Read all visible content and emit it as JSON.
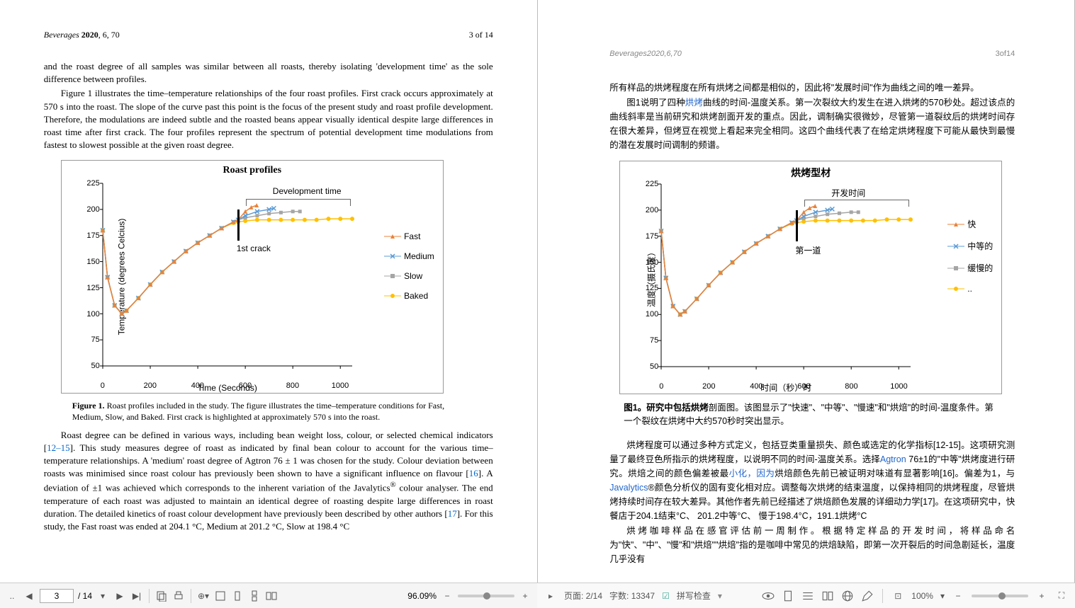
{
  "left": {
    "header": {
      "journal": "Beverages",
      "year": "2020",
      "vol": ", 6, 70",
      "pagenum": "3 of 14"
    },
    "para1_lead": "and the roast degree of all samples was similar between all roasts, thereby isolating 'development time' as the sole difference between profiles.",
    "para2": "Figure 1 illustrates the time–temperature relationships of the four roast profiles. First crack occurs approximately at 570 s into the roast. The slope of the curve past this point is the focus of the present study and roast profile development. Therefore, the modulations are indeed subtle and the roasted beans appear visually identical despite large differences in roast time after first crack. The four profiles represent the spectrum of potential development time modulations from fastest to slowest possible at the given roast degree.",
    "caption_b": "Figure 1.",
    "caption": " Roast profiles included in the study. The figure illustrates the time–temperature conditions for Fast, Medium, Slow, and Baked. First crack is highlighted at approximately 570 s into the roast.",
    "para3a": "Roast degree can be defined in various ways, including bean weight loss, colour, or selected chemical indicators [",
    "ref1": "12–15",
    "para3b": "]. This study measures degree of roast as indicated by final bean colour to account for the various time–temperature relationships. A 'medium' roast degree of Agtron 76 ± 1 was chosen for the study. Colour deviation between roasts was minimised since roast colour has previously been shown to have a significant influence on flavour [",
    "ref2": "16",
    "para3c": "]. A deviation of ±1 was achieved which corresponds to the inherent variation of the Javalytics",
    "reg": "®",
    "para3d": " colour analyser. The end temperature of each roast was adjusted to maintain an identical degree of roasting despite large differences in roast duration. The detailed kinetics of roast colour development have previously been described by other authors [",
    "ref3": "17",
    "para3e": "]. For this study, the Fast roast was ended at 204.1 °C, Medium at 201.2 °C, Slow at 198.4 °C"
  },
  "right": {
    "header": {
      "journal_full": "Beverages2020,6,70",
      "pagenum": "3of14"
    },
    "para1": "所有样品的烘烤程度在所有烘烤之间都是相似的，因此将\"发展时间\"作为曲线之间的唯一差异。",
    "para2a": "图1说明了四种",
    "link1": "烘烤",
    "para2b": "曲线的时间-温度关系。第一次裂纹大约发生在进入烘烤的570秒处。超过该点的曲线斜率是当前研究和烘烤剖面开发的重点。因此，调制确实很微妙，尽管第一道裂纹后的烘烤时间存在很大差异，但烤豆在视觉上看起来完全相同。这四个曲线代表了在给定烘烤程度下可能从最快到最慢的潜在发展时间调制的频谱。",
    "caption_b": "图1。研究中包括烘烤",
    "caption": "剖面图。该图显示了\"快速\"、\"中等\"、\"慢速\"和\"烘焙\"的时间-温度条件。第一个裂纹在烘烤中大约570秒时突出显示。",
    "para3a": "烘烤程度可以通过多种方式定义，包括豆类重量损失、颜色或选定的化学指标[12-15]。这项研究测量了最终豆色所指示的烘烤程度，以说明不同的时间-温度关系。选择",
    "link2": "Agtron",
    "para3b": " 76±1的\"中等\"烘烤度进行研究。烘焙之间的颜色偏差被最",
    "link3": "小化，因为",
    "para3c": "烘焙颜色先前已被证明对味道有显著影响[16]。偏差为1，与",
    "link4": "Javalytics",
    "para3d": "®颜色分析仪的固有变化相对应。调整每次烘烤的结束温度，以保持相同的烘烤程度，尽管烘烤持续时间存在较大差异。其他作者先前已经描述了烘焙颜色发展的详细动力学[17]。在这项研究中，快餐店于204.1结束°C、 201.2中等°C、 慢于198.4°C，191.1烘烤°C",
    "para4": "烘烤咖啡样品在感官评估前一周制作。根据特定样品的开发时间，将样品命名为\"快\"、\"中\"、\"慢\"和\"烘焙\"\"烘焙\"指的是咖啡中常见的烘焙缺陷，即第一次开裂后的时间急剧延长，温度几乎没有"
  },
  "chart_data": {
    "type": "line",
    "title_en": "Roast profiles",
    "title_cn": "烘烤型材",
    "xlabel_en": "Time (Seconds)",
    "xlabel_cn": "时间（秒）时",
    "ylabel_en": "Temperature (degrees Celcius)",
    "ylabel_cn": "温度（摄氏度）",
    "x_ticks": [
      0,
      200,
      400,
      600,
      800,
      1000
    ],
    "y_ticks": [
      50,
      75,
      100,
      125,
      150,
      175,
      200,
      225
    ],
    "x_range": [
      0,
      1050
    ],
    "y_range": [
      50,
      225
    ],
    "annotations": {
      "dev_en": "Development time",
      "dev_cn": "开发时间",
      "crack_en": "1st crack",
      "crack_cn": "第一道",
      "crack_x": 570
    },
    "series": [
      {
        "name_en": "Fast",
        "name_cn": "快",
        "color": "#E8833A",
        "marker": "triangle",
        "x": [
          0,
          20,
          50,
          80,
          100,
          150,
          200,
          250,
          300,
          350,
          400,
          450,
          500,
          550,
          570,
          600,
          625,
          648
        ],
        "y": [
          180,
          135,
          108,
          100,
          103,
          115,
          128,
          140,
          150,
          160,
          168,
          175,
          182,
          188,
          190,
          198,
          202,
          204
        ]
      },
      {
        "name_en": "Medium",
        "name_cn": "中等的",
        "color": "#5B9BD5",
        "marker": "x",
        "x": [
          0,
          20,
          50,
          80,
          100,
          150,
          200,
          250,
          300,
          350,
          400,
          450,
          500,
          550,
          570,
          600,
          650,
          700,
          720
        ],
        "y": [
          180,
          135,
          108,
          100,
          103,
          115,
          128,
          140,
          150,
          160,
          168,
          175,
          182,
          188,
          190,
          194,
          198,
          200,
          201
        ]
      },
      {
        "name_en": "Slow",
        "name_cn": "缓慢的",
        "color": "#A5A5A5",
        "marker": "square",
        "x": [
          0,
          20,
          50,
          80,
          100,
          150,
          200,
          250,
          300,
          350,
          400,
          450,
          500,
          550,
          570,
          600,
          650,
          700,
          750,
          800,
          830
        ],
        "y": [
          180,
          135,
          108,
          100,
          103,
          115,
          128,
          140,
          150,
          160,
          168,
          175,
          182,
          188,
          190,
          192,
          194,
          196,
          197,
          198,
          198
        ]
      },
      {
        "name_en": "Baked",
        "name_cn": "..",
        "color": "#FFC000",
        "marker": "circle",
        "x": [
          0,
          20,
          50,
          80,
          100,
          150,
          200,
          250,
          300,
          350,
          400,
          450,
          500,
          550,
          570,
          600,
          650,
          700,
          750,
          800,
          850,
          900,
          950,
          1000,
          1050
        ],
        "y": [
          180,
          135,
          108,
          100,
          103,
          115,
          128,
          140,
          150,
          160,
          168,
          175,
          182,
          187,
          188,
          189,
          190,
          190,
          190,
          190,
          190,
          190,
          191,
          191,
          191
        ]
      }
    ]
  },
  "toolbar_left": {
    "page_current": "3",
    "page_total": "/ 14",
    "zoom": "96.09%"
  },
  "toolbar_right": {
    "page": "页面: 2/14",
    "words": "字数: 13347",
    "spell": "拼写检查",
    "zoom": "100%"
  }
}
